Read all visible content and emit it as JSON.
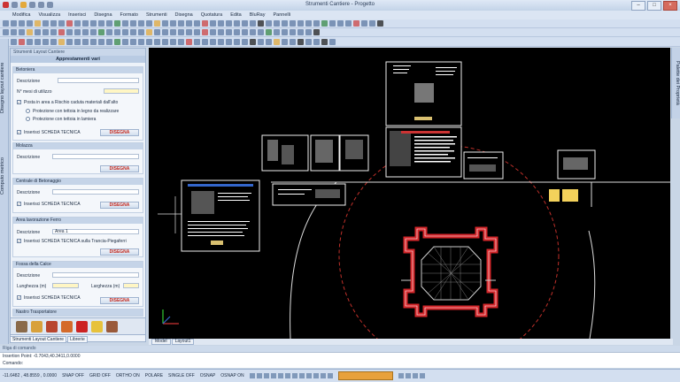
{
  "window": {
    "title": "Strumenti Cantiere - Progetto"
  },
  "menu": [
    "Modifica",
    "Visualizza",
    "Inserisci",
    "Disegna",
    "Formato",
    "Strumenti",
    "Disegna",
    "Quotatura",
    "Edita",
    "BluRay",
    "Pannelli"
  ],
  "side_tabs": {
    "left_top": "Disegno layout cantiere",
    "left_bottom": "Computo metrico",
    "right": "Palette dei Proprietà"
  },
  "panel": {
    "header": "Strumenti Layout Cantiere",
    "subtitle": "Apprestamenti vari",
    "sections": {
      "betoniera": {
        "title": "Betoniera",
        "descrizione_label": "Descrizione",
        "mesi_label": "N° mesi di utilizzo",
        "posta_label": "Posta in area a Rischio caduta materiali dall'alto",
        "opt1": "Protezione con tettoia in legno da realizzare",
        "opt2": "Protezione con tettoia in lamiera",
        "scheda_label": "Inserisci SCHEDA TECNICA",
        "button": "DISEGNA"
      },
      "molazza": {
        "title": "Molazza",
        "descrizione_label": "Descrizione",
        "button": "DISEGNA"
      },
      "centrale": {
        "title": "Centrale di Betonaggio",
        "descrizione_label": "Descrizione",
        "scheda_label": "Inserisci SCHEDA TECNICA",
        "button": "DISEGNA"
      },
      "area_ferro": {
        "title": "Area lavorazione Ferro",
        "descrizione_label": "Descrizione",
        "descrizione_value": "Area 1",
        "scheda_label": "Inserisci SCHEDA TECNICA sulla Trancia-Piegaferri",
        "button": "DISEGNA"
      },
      "fossa": {
        "title": "Fossa della Calce",
        "descrizione_label": "Descrizione",
        "lunghezza_label": "Lunghezza (m)",
        "larghezza_label": "Larghezza (m)",
        "scheda_label": "Inserisci SCHEDA TECNICA",
        "button": "DISEGNA"
      },
      "nastro": {
        "title": "Nastro Trasportatore"
      }
    },
    "tabs": [
      "Strumenti Layout Cantiere",
      "Librerie"
    ]
  },
  "canvas_tabs": [
    "Model",
    "Layout1"
  ],
  "command": {
    "header": "Riga di comando",
    "line1": "Insertion Point: -0.7043,40.3411,0.0000",
    "line2": "Comando:"
  },
  "status": {
    "coords": "-11.6482 , 48.8559 , 0.0000",
    "toggles": [
      "SNAP OFF",
      "GRID OFF",
      "ORTHO ON",
      "POLARE",
      "SINGLE OFF",
      "OSNAP",
      "OSNAP ON"
    ]
  },
  "colors": {
    "canvas_bg": "#000000",
    "accent_red": "#c2281e",
    "panel_bg": "#edf2f9",
    "frame_blue": "#c3d2e7"
  }
}
